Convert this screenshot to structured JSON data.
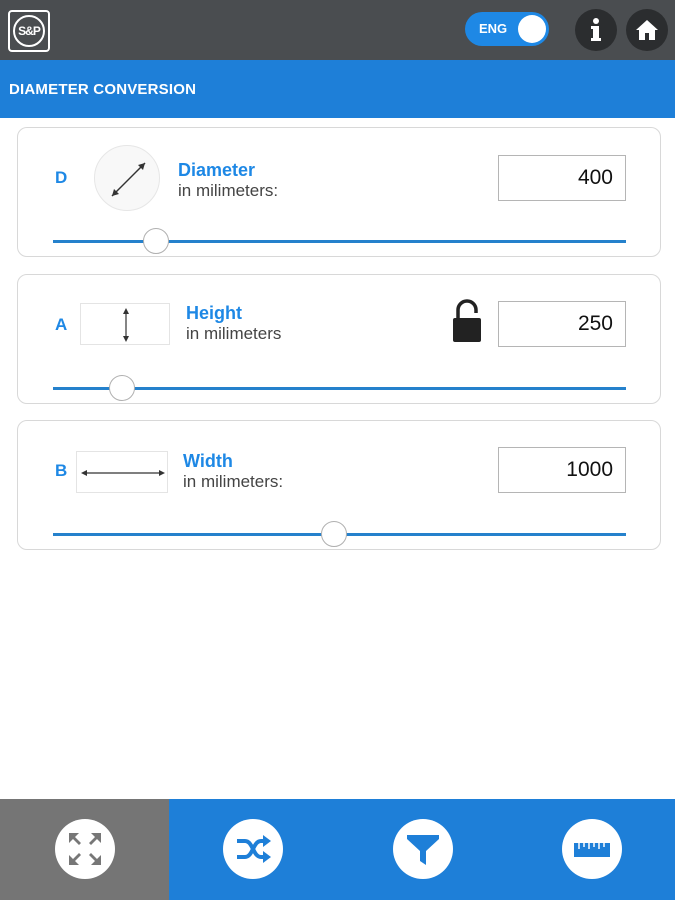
{
  "header": {
    "logo_text": "S&P",
    "language": {
      "label": "ENG",
      "enabled": true
    },
    "info_icon": "info-icon",
    "home_icon": "home-icon"
  },
  "title": "DIAMETER CONVERSION",
  "fields": [
    {
      "letter": "D",
      "label": "Diameter",
      "sublabel": "in milimeters:",
      "value": "400",
      "slider_fraction": 0.18,
      "icon": "diagonal-arrow-icon"
    },
    {
      "letter": "A",
      "label": "Height",
      "sublabel": "in milimeters",
      "value": "250",
      "slider_fraction": 0.12,
      "icon": "vertical-arrow-icon",
      "lock_icon": "unlocked-padlock-icon"
    },
    {
      "letter": "B",
      "label": "Width",
      "sublabel": "in milimeters:",
      "value": "1000",
      "slider_fraction": 0.49,
      "icon": "horizontal-arrow-icon"
    }
  ],
  "bottom_nav": [
    {
      "icon": "expand-icon",
      "active": true
    },
    {
      "icon": "shuffle-icon",
      "active": false
    },
    {
      "icon": "filter-icon",
      "active": false
    },
    {
      "icon": "ruler-icon",
      "active": false
    }
  ],
  "colors": {
    "accent": "#1e7fd8",
    "topbar": "#4a4d50",
    "nav_active": "#757575"
  }
}
